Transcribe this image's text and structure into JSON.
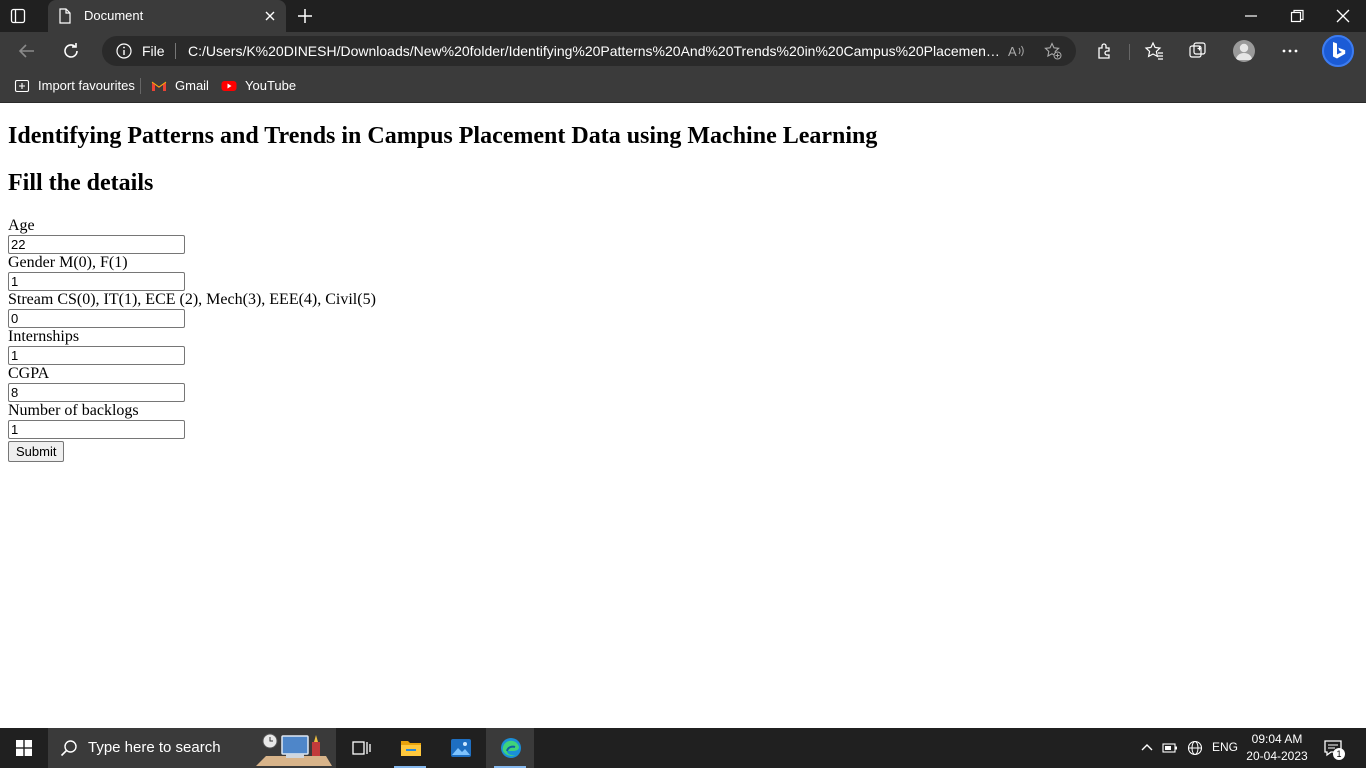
{
  "browser": {
    "tab_title": "Document",
    "address": {
      "scheme_label": "File",
      "url": "C:/Users/K%20DINESH/Downloads/New%20folder/Identifying%20Patterns%20And%20Trends%20in%20Campus%20Placement/Fl..."
    },
    "bookmarks": [
      {
        "label": "Import favourites",
        "icon": "import-icon"
      },
      {
        "label": "Gmail",
        "icon": "gmail-icon"
      },
      {
        "label": "YouTube",
        "icon": "youtube-icon"
      }
    ]
  },
  "page": {
    "title": "Identifying Patterns and Trends in Campus Placement Data using Machine Learning",
    "subtitle": "Fill the details",
    "fields": [
      {
        "label": "Age",
        "value": "22"
      },
      {
        "label": "Gender M(0), F(1)",
        "value": "1"
      },
      {
        "label": "Stream CS(0), IT(1), ECE (2), Mech(3), EEE(4), Civil(5)",
        "value": "0"
      },
      {
        "label": "Internships",
        "value": "1"
      },
      {
        "label": "CGPA",
        "value": "8"
      },
      {
        "label": "Number of backlogs",
        "value": "1"
      }
    ],
    "submit_label": "Submit"
  },
  "taskbar": {
    "search_placeholder": "Type here to search",
    "language": "ENG",
    "time": "09:04 AM",
    "date": "20-04-2023",
    "notification_count": "1"
  }
}
